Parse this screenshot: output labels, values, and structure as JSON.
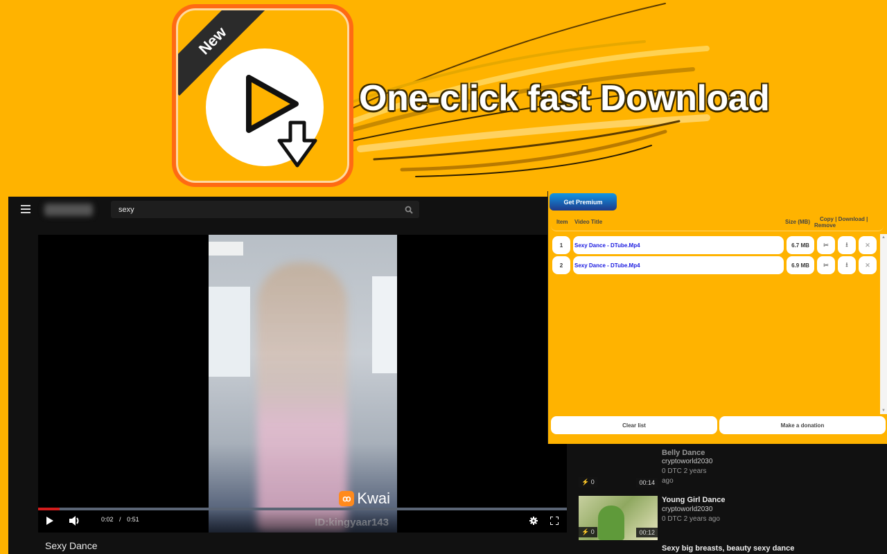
{
  "banner": {
    "badge": "New",
    "tagline": "One-click fast Download"
  },
  "site": {
    "search": {
      "value": "sexy"
    },
    "player": {
      "current_time": "0:02",
      "separator": "/",
      "duration": "0:51",
      "progress_percent": 4,
      "watermark_brand": "Kwai",
      "watermark_id": "ID:kingyaar143"
    },
    "video_title": "Sexy Dance",
    "related": [
      {
        "title": "Belly Dance",
        "channel": "cryptoworld2030",
        "meta": "0 DTC  2 years",
        "meta2": "ago",
        "votes": "0",
        "duration": "00:14"
      },
      {
        "title": "Young Girl Dance",
        "channel": "cryptoworld2030",
        "meta": "0 DTC  2 years ago",
        "votes": "0",
        "duration": "00:12"
      },
      {
        "title": "Sexy big breasts, beauty sexy dance"
      }
    ]
  },
  "extension": {
    "premium_label": "Get Premium",
    "headers": {
      "item": "Item",
      "title": "Video Title",
      "size": "Size (MB)",
      "actions_line1": "Copy | Download |",
      "actions_line2": "Remove"
    },
    "rows": [
      {
        "item": "1",
        "title": "Sexy Dance - DTube.Mp4",
        "size": "6.7 MB"
      },
      {
        "item": "2",
        "title": "Sexy Dance - DTube.Mp4",
        "size": "6.9 MB"
      }
    ],
    "icons": {
      "copy": "✂",
      "download": "⭳",
      "remove": "✕"
    },
    "clear_label": "Clear list",
    "donate_label": "Make a donation"
  }
}
